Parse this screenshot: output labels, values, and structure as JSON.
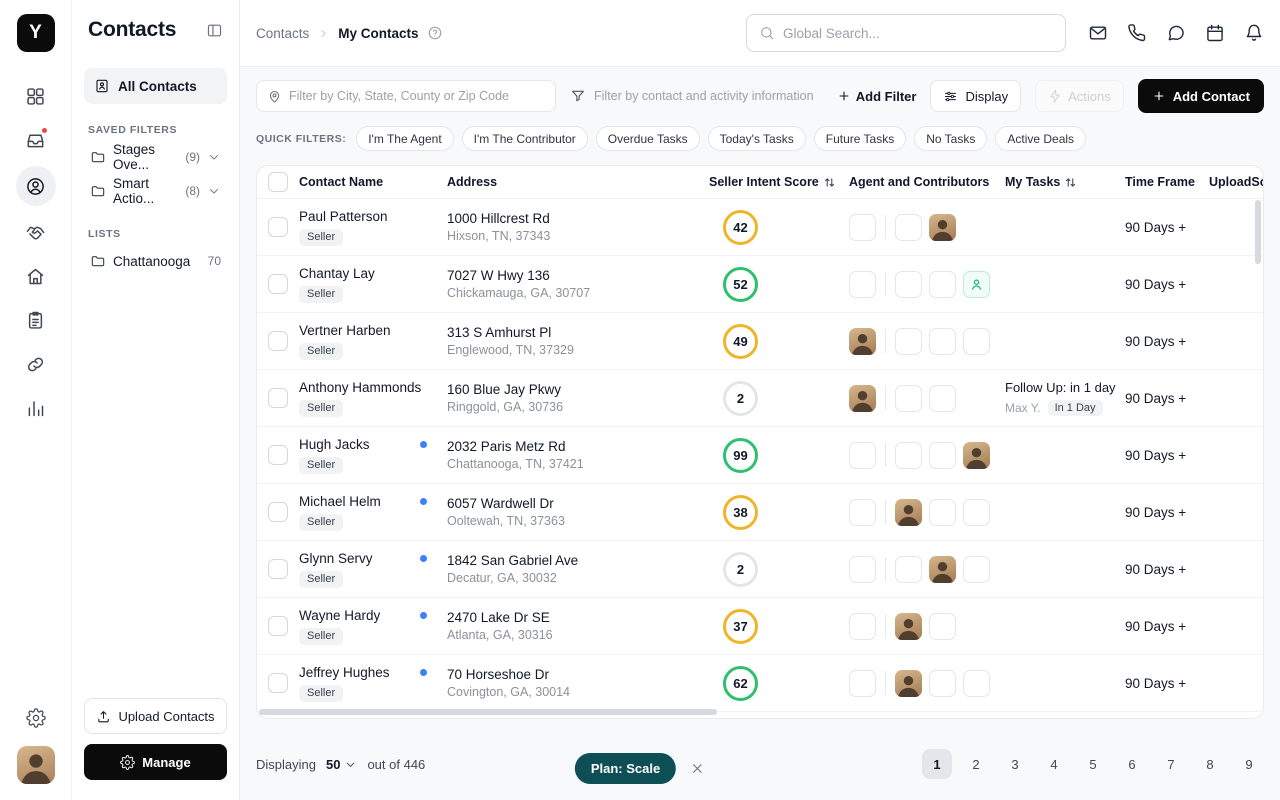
{
  "app": {
    "logo_letter": "Y"
  },
  "theme": {
    "primary_button": "#0b0b0c",
    "plan_badge": "#0e4f55",
    "score_yellow": "#f0b429",
    "score_green": "#2fbf71",
    "score_gray": "#e3e5e8",
    "unread_dot": "#3b82f6",
    "notification_dot": "#ef4444",
    "agent_icon_green": "#10b981"
  },
  "rail": {
    "items": [
      {
        "icon": "dashboard",
        "active": false,
        "badge": false
      },
      {
        "icon": "inbox",
        "active": false,
        "badge": true
      },
      {
        "icon": "contacts",
        "active": true,
        "badge": false
      },
      {
        "icon": "deals",
        "active": false,
        "badge": false
      },
      {
        "icon": "home",
        "active": false,
        "badge": false
      },
      {
        "icon": "tasks",
        "active": false,
        "badge": false
      },
      {
        "icon": "links",
        "active": false,
        "badge": false
      },
      {
        "icon": "analytics",
        "active": false,
        "badge": false
      }
    ]
  },
  "sidebar": {
    "title": "Contacts",
    "all_contacts": "All Contacts",
    "saved_filters_label": "SAVED FILTERS",
    "saved_filters": [
      {
        "label": "Stages Ove...",
        "count": "(9)"
      },
      {
        "label": "Smart Actio...",
        "count": "(8)"
      }
    ],
    "lists_label": "LISTS",
    "lists": [
      {
        "label": "Chattanooga",
        "count": "70"
      }
    ],
    "upload_button": "Upload Contacts",
    "manage_button": "Manage"
  },
  "breadcrumb": {
    "root": "Contacts",
    "current": "My Contacts"
  },
  "search": {
    "placeholder": "Global Search..."
  },
  "header": {
    "icons": [
      "mail",
      "phone",
      "chat",
      "calendar",
      "bell"
    ]
  },
  "toolbar": {
    "location_placeholder": "Filter by City, State, County or Zip Code",
    "contact_placeholder": "Filter by contact and activity information",
    "add_filter_label": "Add Filter",
    "display_label": "Display",
    "actions_label": "Actions",
    "add_contact_label": "Add Contact"
  },
  "quick_filters": {
    "label": "QUICK FILTERS:",
    "items": [
      "I'm The Agent",
      "I'm The Contributor",
      "Overdue Tasks",
      "Today's Tasks",
      "Future Tasks",
      "No Tasks",
      "Active Deals"
    ]
  },
  "table": {
    "columns": [
      {
        "label": "Contact Name",
        "sortable": false
      },
      {
        "label": "Address",
        "sortable": false
      },
      {
        "label": "Seller Intent Score",
        "sortable": true
      },
      {
        "label": "Agent and Contributors",
        "sortable": false
      },
      {
        "label": "My Tasks",
        "sortable": true
      },
      {
        "label": "Time Frame",
        "sortable": false
      },
      {
        "label": "UploadSo",
        "sortable": false
      }
    ],
    "rows": [
      {
        "name": "Paul Patterson",
        "badge": "Seller",
        "new": false,
        "address1": "1000 Hillcrest Rd",
        "address2": "Hixson, TN, 37343",
        "score": 42,
        "score_color": "yellow",
        "agent": "empty",
        "contributors": [
          "empty",
          "photo"
        ],
        "task": null,
        "time_frame": "90 Days +"
      },
      {
        "name": "Chantay Lay",
        "badge": "Seller",
        "new": false,
        "address1": "7027 W Hwy 136",
        "address2": "Chickamauga, GA, 30707",
        "score": 52,
        "score_color": "green",
        "agent": "empty",
        "contributors": [
          "empty",
          "empty",
          "agent"
        ],
        "task": null,
        "time_frame": "90 Days +"
      },
      {
        "name": "Vertner Harben",
        "badge": "Seller",
        "new": false,
        "address1": "313 S Amhurst Pl",
        "address2": "Englewood, TN, 37329",
        "score": 49,
        "score_color": "yellow",
        "agent": "photo",
        "contributors": [
          "empty",
          "empty",
          "empty"
        ],
        "task": null,
        "time_frame": "90 Days +"
      },
      {
        "name": "Anthony Hammonds",
        "badge": "Seller",
        "new": false,
        "address1": "160 Blue Jay Pkwy",
        "address2": "Ringgold, GA, 30736",
        "score": 2,
        "score_color": "gray",
        "agent": "photo",
        "contributors": [
          "empty",
          "empty"
        ],
        "task": {
          "title": "Follow Up: in 1 day",
          "assignee": "Max Y.",
          "badge": "In 1 Day"
        },
        "time_frame": "90 Days +"
      },
      {
        "name": "Hugh Jacks",
        "badge": "Seller",
        "new": true,
        "address1": "2032 Paris Metz Rd",
        "address2": "Chattanooga, TN, 37421",
        "score": 99,
        "score_color": "green",
        "agent": "empty",
        "contributors": [
          "empty",
          "empty",
          "photo"
        ],
        "task": null,
        "time_frame": "90 Days +"
      },
      {
        "name": "Michael Helm",
        "badge": "Seller",
        "new": true,
        "address1": "6057 Wardwell Dr",
        "address2": "Ooltewah, TN, 37363",
        "score": 38,
        "score_color": "yellow",
        "agent": "empty",
        "contributors": [
          "photo",
          "empty",
          "empty"
        ],
        "task": null,
        "time_frame": "90 Days +"
      },
      {
        "name": "Glynn Servy",
        "badge": "Seller",
        "new": true,
        "address1": "1842 San Gabriel Ave",
        "address2": "Decatur, GA, 30032",
        "score": 2,
        "score_color": "gray",
        "agent": "empty",
        "contributors": [
          "empty",
          "photo",
          "empty"
        ],
        "task": null,
        "time_frame": "90 Days +"
      },
      {
        "name": "Wayne Hardy",
        "badge": "Seller",
        "new": true,
        "address1": "2470 Lake Dr SE",
        "address2": "Atlanta, GA, 30316",
        "score": 37,
        "score_color": "yellow",
        "agent": "empty",
        "contributors": [
          "photo",
          "empty"
        ],
        "task": null,
        "time_frame": "90 Days +"
      },
      {
        "name": "Jeffrey Hughes",
        "badge": "Seller",
        "new": true,
        "address1": "70 Horseshoe Dr",
        "address2": "Covington, GA, 30014",
        "score": 62,
        "score_color": "green",
        "agent": "empty",
        "contributors": [
          "photo",
          "empty",
          "empty"
        ],
        "task": null,
        "time_frame": "90 Days +"
      }
    ]
  },
  "footer": {
    "displaying": "Displaying",
    "page_size": "50",
    "out_of": "out of 446",
    "plan": "Plan: Scale",
    "pages": [
      "1",
      "2",
      "3",
      "4",
      "5",
      "6",
      "7",
      "8",
      "9"
    ],
    "active_page": "1"
  }
}
